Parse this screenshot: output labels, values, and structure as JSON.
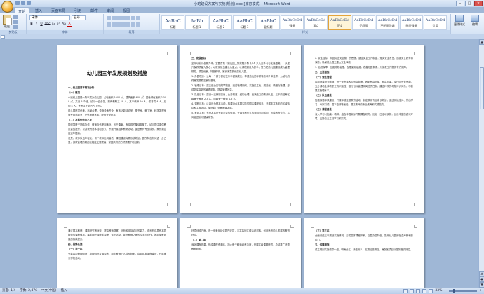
{
  "window": {
    "title": "小班建设方案与实施(规划).doc [兼容模式] - Microsoft Word",
    "controls": [
      "–",
      "□",
      "×"
    ]
  },
  "tabs": [
    {
      "label": "开始",
      "active": true
    },
    {
      "label": "插入",
      "active": false
    },
    {
      "label": "页面布局",
      "active": false
    },
    {
      "label": "引用",
      "active": false
    },
    {
      "label": "邮件",
      "active": false
    },
    {
      "label": "审阅",
      "active": false
    },
    {
      "label": "视图",
      "active": false
    }
  ],
  "ribbon": {
    "clipboard": {
      "paste_label": "粘贴",
      "group_label": "剪贴板"
    },
    "font": {
      "family": "宋体",
      "size": "五号",
      "group_label": "字体",
      "format_buttons": [
        "B",
        "I",
        "U",
        "abc",
        "x₂",
        "x²",
        "Aa",
        "A"
      ]
    },
    "paragraph": {
      "group_label": "段落"
    },
    "styles": {
      "group_label": "样式",
      "items": [
        {
          "sample": "AaBbC",
          "name": "标题"
        },
        {
          "sample": "AaBb",
          "name": "标题 1"
        },
        {
          "sample": "AaBbC",
          "name": "标题 2"
        },
        {
          "sample": "AaBbC",
          "name": "标题 3"
        },
        {
          "sample": "AaBbC",
          "name": "副标题"
        },
        {
          "sample": "AaBbCcDd",
          "name": "强调"
        },
        {
          "sample": "AaBbCcDd",
          "name": "要点"
        },
        {
          "sample": "AaBbCcDd",
          "name": "正文",
          "selected": true
        },
        {
          "sample": "AaBbCcDd",
          "name": "无间隔"
        },
        {
          "sample": "AaBbCcDd",
          "name": "不明显强调"
        },
        {
          "sample": "AaBbCcDd",
          "name": "明显强调"
        },
        {
          "sample": "AaBbCcDd",
          "name": "引用"
        },
        {
          "sample": "AaBbCcDd",
          "name": "明显引用"
        },
        {
          "sample": "AaBbCcDd",
          "name": "不明显参考"
        }
      ],
      "change_styles": "更改样式"
    },
    "editing": {
      "label": "编辑",
      "group_label": "编辑"
    }
  },
  "document": {
    "title": "幼儿园三年发展规划及措施",
    "page1": [
      {
        "type": "head",
        "text": "一、幼儿园基本情况分析"
      },
      {
        "type": "head",
        "text": "（一）概况"
      },
      {
        "type": "text",
        "text": "小班幼儿园是一所市属办幼儿园，占地面积 1000 ㎡，建筑面积 600 ㎡，园舍绿化面积 2 000 ㎡，共设 5 个班，幼儿一百余名。现有教职工 18 人，其中教师 10 人，保育员 4 人，后勤 4 人，大专以上学历占 70%。"
      },
      {
        "type": "text",
        "text": "幼儿园环境优美，布局合理，设施设备齐全，有多功能活动室、图书室、美工室、科学发现室等专用活动室，户外场地宽敞，配有大型玩具。"
      },
      {
        "type": "head",
        "text": "（二）发展优势与不足"
      },
      {
        "type": "text",
        "text": "园领导班子团结协作，教师队伍爱岗敬业、乐于奉献，有较强的集体凝聚力。幼儿园注重保教质量的提升，以游戏为基本活动形式，积极开展园本教研活动，促进教师专业成长，家长满意度逐年提高。"
      },
      {
        "type": "text",
        "text": "但是，教师队伍年轻化，骨干教师比例偏低，课程建设尚需系统规划，园所特色有待进一步凸显，保教管理的精细化程度还需提高，家园共育的方式需要不断创新。"
      }
    ],
    "page2": [
      {
        "type": "head",
        "text": "二、发展目标"
      },
      {
        "type": "text",
        "text": "坚持以幼儿发展为本，全面贯彻《幼儿园工作规程》和《3-6 岁儿童学习与发展指南》，以提升保教质量为核心，以教师队伍建设为重点，以课程建设为抓手，努力把幼儿园建设成为管理规范、质量优良、特色鲜明、家长满意的优质幼儿园。"
      },
      {
        "type": "text",
        "text": "1. 办园理念：让每一个孩子都在快乐中健康成长，尊重幼儿的年龄特点和个体差异，为幼儿的终身发展奠定良好基础。"
      },
      {
        "type": "text",
        "text": "2. 管理目标：建立健全各项规章制度，完善管理网络，实施民主化、规范化、精细化管理，形成务实高效的管理机制，提高管理效益。"
      },
      {
        "type": "text",
        "text": "3. 队伍目标：建设一支师德高尚、业务精湛、结构合理、充满活力的教师队伍，三年内培养区级骨干教师 2-3 名，园级骨干教师 4-5 名。"
      },
      {
        "type": "text",
        "text": "4. 课程目标：以游戏为基本活动，构建适合本园实际的园本课程体系，开展丰富多彩的区域活动和主题活动，促进幼儿全面和谐发展。"
      },
      {
        "type": "text",
        "text": "5. 家园共育：充分发挥家长委员会的作用，开展多种形式的家园互动活动，形成教育合力，共同促进幼儿健康成长。"
      }
    ],
    "page3": [
      {
        "type": "text",
        "text": "6. 安全目标：牢固树立安全第一的思想，健全安全工作制度，落实安全责任，加强安全教育和演练，确保幼儿园无重大安全事故。"
      },
      {
        "type": "text",
        "text": "7. 后勤保障：加强财务管理，合理使用经费，改善办园条件，为保教工作提供有力保障。"
      },
      {
        "type": "head",
        "text": "三、主要措施"
      },
      {
        "type": "head",
        "text": "（一）强化管理"
      },
      {
        "type": "text",
        "text": "以制度建设为基础，进一步完善各项规章制度，做到有章可循、照章办事。实行园长负责制，充分调动全体教职工的积极性，推行目标管理和岗位责任制，建立科学的考核评价体系，不断提高管理水平。"
      },
      {
        "type": "head",
        "text": "（二）队伍建设"
      },
      {
        "type": "text",
        "text": "加强师德师风建设，开展师德主题教育活动。制定教师专业成长规划，通过师徒结对、外出学习、专家引领、园本培训等途径，提高教师的专业素养和实践能力。"
      },
      {
        "type": "head",
        "text": "（三）课程建设"
      },
      {
        "type": "text",
        "text": "深入学习《指南》精神，结合本园实际开展课程研究，优化一日活动安排，创设丰富的游戏环境，支持幼儿主动学习和探究。"
      }
    ],
    "page4": [
      {
        "type": "text",
        "text": "通过园本教研、课题研究等途径，提高教师观察、分析和支持幼儿的能力，逐步形成具有本园特色的课程体系，每学期开展教学观摩、评比活动，促进教师之间的交流与合作，推动保教质量的持续提升。"
      },
      {
        "type": "head",
        "text": "四、具体实施"
      },
      {
        "type": "head",
        "text": "（一）第一年"
      },
      {
        "type": "text",
        "text": "完善各项管理制度，梳理园所发展现状，制定教师个人成长规划，启动园本课程建设，开展家长学校活动。"
      }
    ],
    "page5": [
      {
        "type": "text",
        "text": "环境创设方面，进一步美化绿化园所环境，丰富各班区域活动材料，创设适宜幼儿发展的教育环境。"
      },
      {
        "type": "head",
        "text": "（二）第二年"
      },
      {
        "type": "text",
        "text": "深化课程改革，形成课程资源库，加大骨干教师培养力度，开展区级课题研究，总结推广优秀教育经验。"
      }
    ],
    "page6": [
      {
        "type": "head",
        "text": "（三）第三年"
      },
      {
        "type": "text",
        "text": "全面总结三年规划实施情况，形成园本课程体系，凸显办园特色，提升幼儿园的社会声誉和影响力。"
      },
      {
        "type": "head",
        "text": "五、保障措施"
      },
      {
        "type": "text",
        "text": "成立规划实施领导小组，明确分工，责任到人，定期检查督促，确保各项目标任务落实到位。"
      }
    ]
  },
  "status": {
    "page": "页面: 1/4",
    "words": "字数: 2,876",
    "language": "中文(中国)",
    "mode": "插入"
  },
  "zoom": {
    "level": "33%",
    "value": 0.33
  }
}
